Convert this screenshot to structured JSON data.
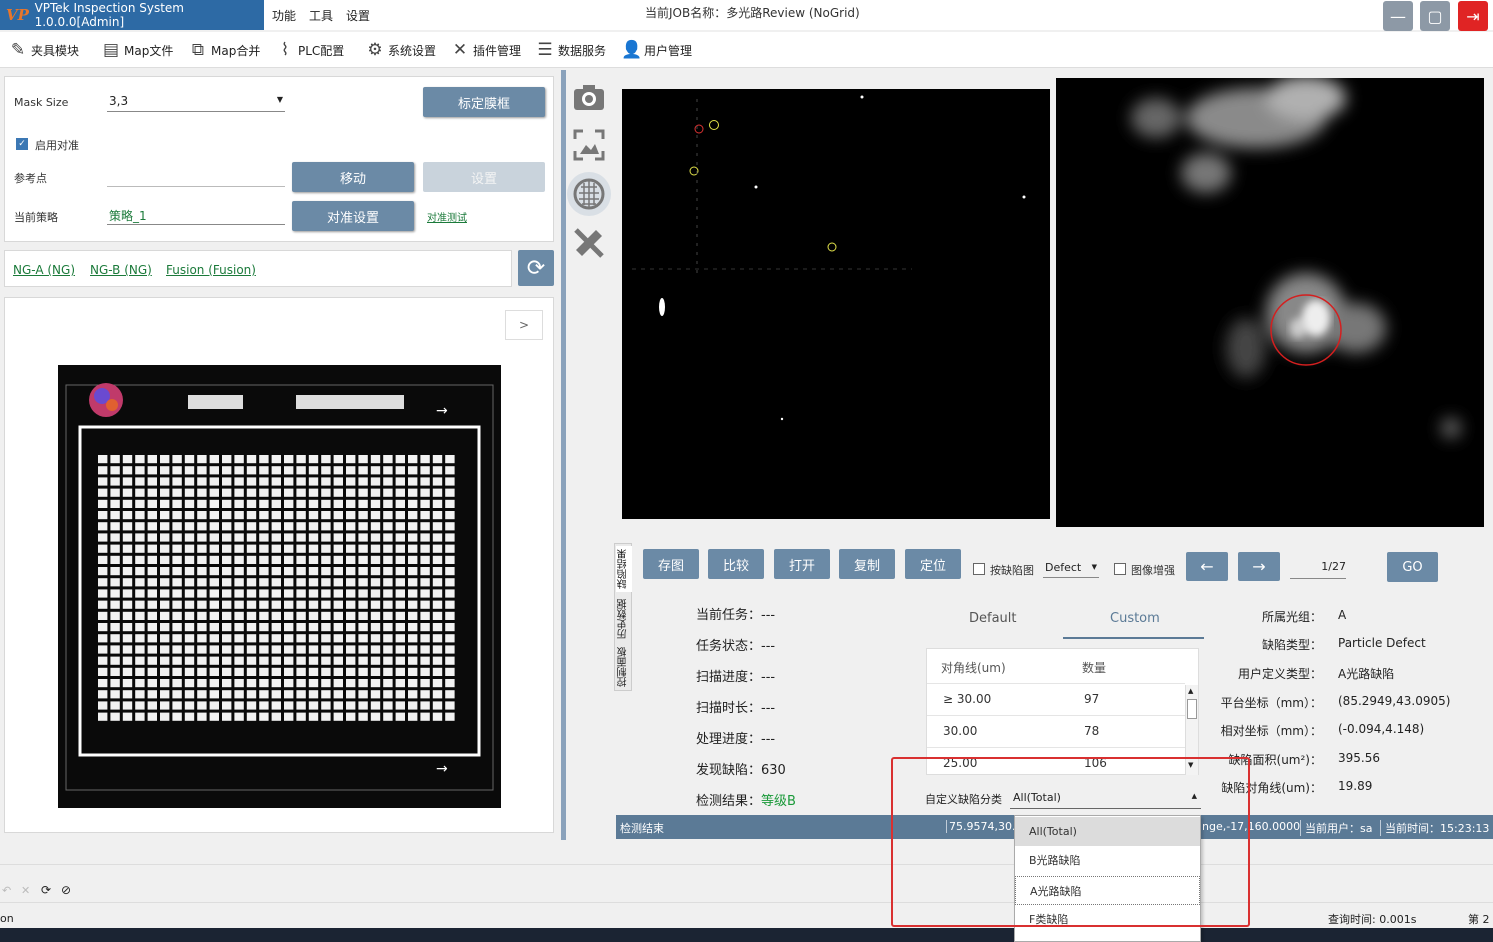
{
  "title_bar": {
    "logo": "VP",
    "app_title": "VPTek Inspection System 1.0.0.0[Admin]",
    "menus": [
      "功能",
      "工具",
      "设置"
    ],
    "job_title": "当前JOB名称：多光路Review (NoGrid)",
    "minimize": "—",
    "maximize": "▢",
    "exit": "⇥"
  },
  "toolbar": {
    "items": [
      {
        "label": "夹具模块",
        "icon": "wrench-icon"
      },
      {
        "label": "Map文件",
        "icon": "file-icon"
      },
      {
        "label": "Map合并",
        "icon": "merge-icon"
      },
      {
        "label": "PLC配置",
        "icon": "plc-icon"
      },
      {
        "label": "系统设置",
        "icon": "gear-icon"
      },
      {
        "label": "插件管理",
        "icon": "tools-icon"
      },
      {
        "label": "数据服务",
        "icon": "server-icon"
      },
      {
        "label": "用户管理",
        "icon": "user-icon"
      }
    ]
  },
  "align_panel": {
    "mask_size_label": "Mask Size",
    "mask_size_value": "3,3",
    "calibrate_button": "标定膜框",
    "enable_align_label": "启用对准",
    "enable_align_checked": true,
    "ref_point_label": "参考点",
    "ref_point_value": "",
    "move_button": "移动",
    "set_button": "设置",
    "strategy_label": "当前策略",
    "strategy_value": "策略_1",
    "align_settings_button": "对准设置",
    "align_test_link": "对准测试"
  },
  "result_tabs": [
    "NG-A (NG)",
    "NG-B (NG)",
    "Fusion (Fusion)"
  ],
  "map_panel": {
    "expand_button": ">"
  },
  "viewer_controls": {
    "buttons": [
      "存图",
      "比较",
      "打开",
      "复制",
      "定位"
    ],
    "by_defect_label": "按缺陷图",
    "defect_select": "Defect",
    "enhance_label": "图像增强",
    "prev": "←",
    "next": "→",
    "page": "1/27",
    "go": "GO"
  },
  "vertical_tabs": [
    "缺陷结果",
    "历史数据",
    "控制面板"
  ],
  "task_info": {
    "rows": [
      {
        "label": "当前任务：",
        "value": "---"
      },
      {
        "label": "任务状态：",
        "value": "---"
      },
      {
        "label": "扫描进度：",
        "value": "---"
      },
      {
        "label": "扫描时长：",
        "value": "---"
      },
      {
        "label": "处理进度：",
        "value": "---"
      },
      {
        "label": "发现缺陷：",
        "value": "630"
      },
      {
        "label": "检测结果：",
        "value": "等级B"
      }
    ]
  },
  "stats_tabs": [
    "Default",
    "Custom"
  ],
  "stats_table": {
    "headers": [
      "对角线(um)",
      "数量"
    ],
    "rows": [
      [
        "≥ 30.00",
        "97"
      ],
      [
        "30.00",
        "78"
      ],
      [
        "25.00",
        "106"
      ]
    ]
  },
  "custom_class": {
    "label": "自定义缺陷分类",
    "value": "All(Total)",
    "options": [
      "All(Total)",
      "B光路缺陷",
      "A光路缺陷",
      "F类缺陷"
    ]
  },
  "defect_info": {
    "rows": [
      {
        "label": "所属光组：",
        "value": "A"
      },
      {
        "label": "缺陷类型：",
        "value": "Particle Defect"
      },
      {
        "label": "用户定义类型：",
        "value": "A光路缺陷"
      },
      {
        "label": "平台坐标（mm）：",
        "value": "(85.2949,43.0905)"
      },
      {
        "label": "相对坐标（mm）：",
        "value": "(-0.094,4.148)"
      },
      {
        "label": "缺陷面积(um²)：",
        "value": "395.56"
      },
      {
        "label": "缺陷对角线(um)：",
        "value": "19.89"
      }
    ]
  },
  "status_bar": {
    "left": "检测结束",
    "coords": "75.9574,30.9",
    "range": "nge,-17,160.0000",
    "user": "当前用户：sa",
    "time": "当前时间：15:23:13"
  },
  "bottom": {
    "left_text": "on",
    "query_time": "查询时间: 0.001s",
    "page_text": "第 2"
  },
  "colors": {
    "accent": "#6b8aa6",
    "title_blue": "#2d6aa5",
    "link_green": "#1b7a3a",
    "highlight_red": "#d93030"
  }
}
